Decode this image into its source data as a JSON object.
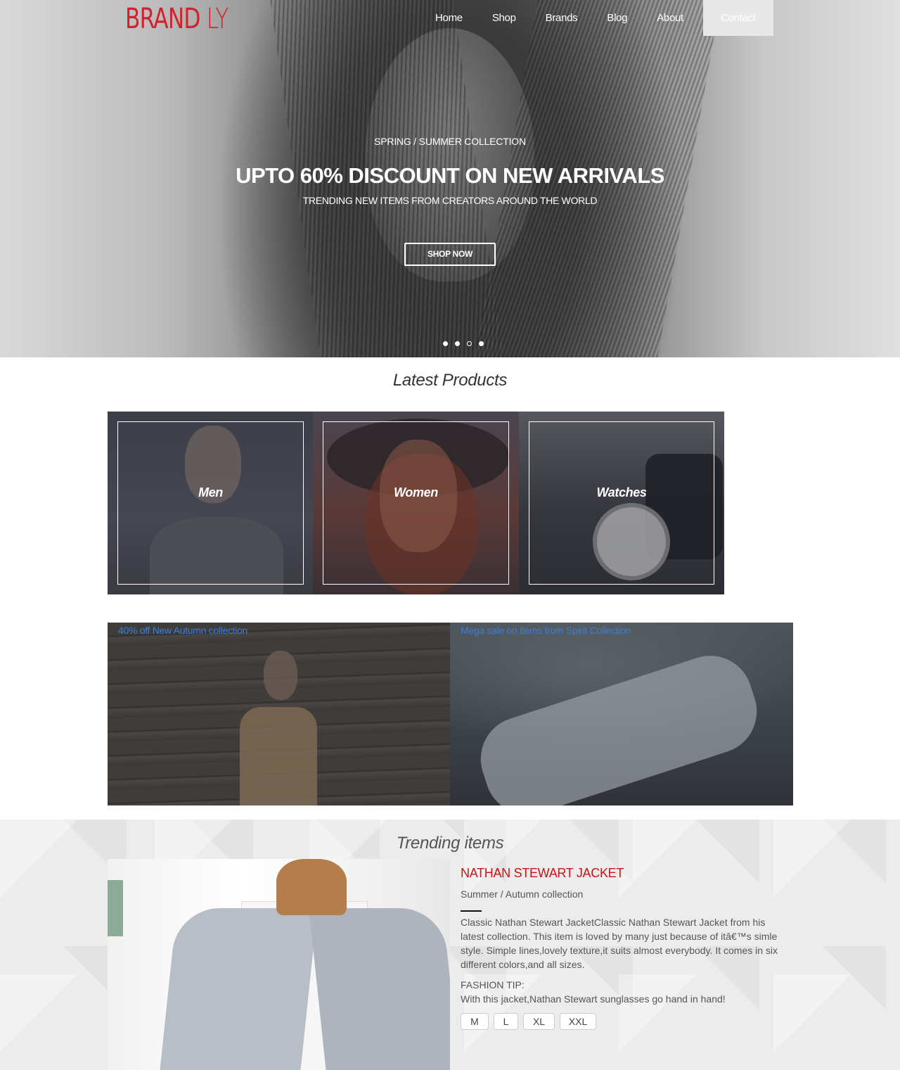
{
  "header": {
    "brand_main": "BRAND",
    "brand_suffix": "LY",
    "nav": [
      {
        "label": "Home"
      },
      {
        "label": "Shop"
      },
      {
        "label": "Brands"
      },
      {
        "label": "Blog"
      },
      {
        "label": "About"
      },
      {
        "label": "Contact",
        "active": true
      }
    ]
  },
  "hero": {
    "kicker": "SPRING / SUMMER COLLECTION",
    "title": "UPTO 60% DISCOUNT ON NEW ARRIVALS",
    "subtitle": "TRENDING NEW ITEMS FROM CREATORS AROUND THE WORLD",
    "cta": "SHOP NOW",
    "slides": 4,
    "active_slide": 3
  },
  "latest": {
    "title": "Latest Products",
    "categories": [
      {
        "label": "Men"
      },
      {
        "label": "Women"
      },
      {
        "label": "Watches"
      }
    ]
  },
  "promos": [
    {
      "text": "40% off New Autumn collection"
    },
    {
      "text": "Mega sale on items from Spirit Collection"
    }
  ],
  "trending": {
    "title": "Trending items",
    "product": {
      "name": "NATHAN STEWART JACKET",
      "collection": "Summer / Autumn collection",
      "description": "Classic Nathan Stewart JacketClassic Nathan Stewart Jacket from his latest collection. This item is loved by many just because of itâ€™s simle style. Simple lines,lovely texture,it suits almost everybody. It comes in six different colors,and all sizes.",
      "tip_label": "FASHION TIP:",
      "tip_text": "With this jacket,Nathan Stewart sunglasses go hand in hand!",
      "sizes": [
        "M",
        "L",
        "XL",
        "XXL"
      ]
    }
  },
  "colors": {
    "brand_red": "#d0232b",
    "product_red": "#c81414",
    "promo_link_blue": "#3a7fd6"
  }
}
